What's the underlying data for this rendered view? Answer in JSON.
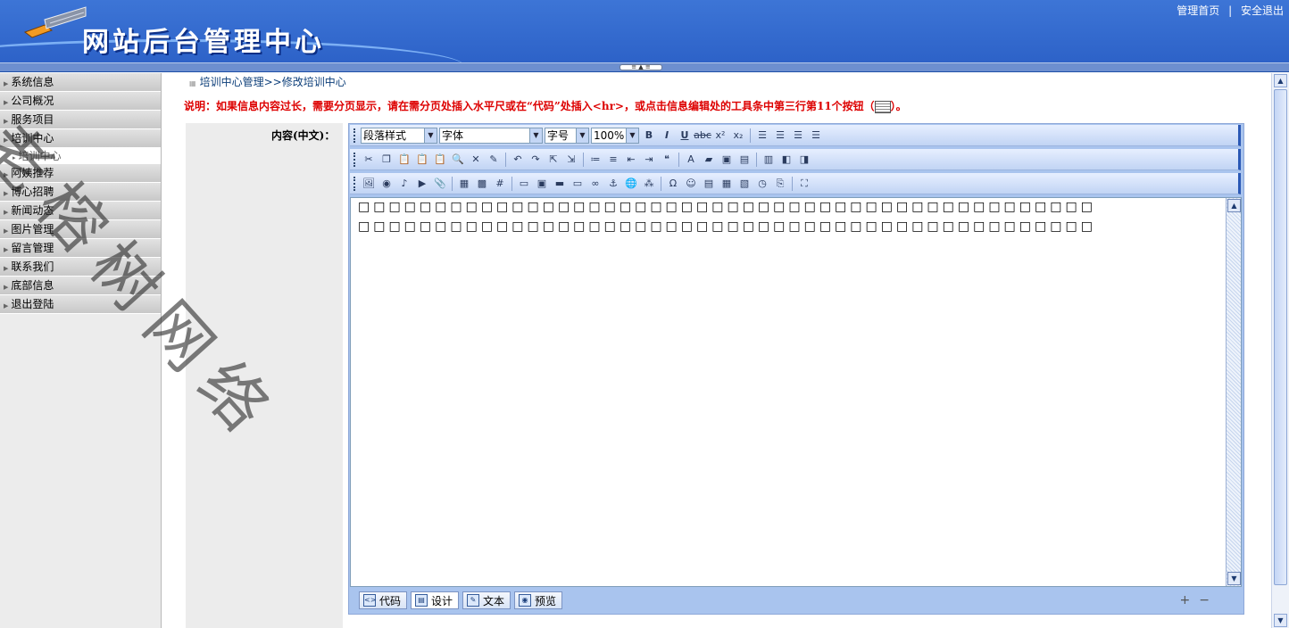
{
  "header": {
    "title": "网站后台管理中心",
    "link_home": "管理首页",
    "separator": "|",
    "link_logout": "安全退出",
    "colors": {
      "header_bg": "#3568d0",
      "accent": "#dd0000"
    }
  },
  "sidebar": {
    "items": [
      {
        "label": "系统信息"
      },
      {
        "label": "公司概况"
      },
      {
        "label": "服务项目"
      },
      {
        "label": "培训中心",
        "sub": "培训中心"
      },
      {
        "label": "阿姨推荐"
      },
      {
        "label": "博心招聘"
      },
      {
        "label": "新闻动态"
      },
      {
        "label": "图片管理"
      },
      {
        "label": "留言管理"
      },
      {
        "label": "联系我们"
      },
      {
        "label": "底部信息"
      },
      {
        "label": "退出登陆"
      }
    ]
  },
  "breadcrumb": {
    "root": "培训中心管理>>",
    "current": "修改培训中心"
  },
  "notice": {
    "text_before": "说明：如果信息内容过长，需要分页显示，请在需分页处插入水平尺或在“代码”处插入<hr>，或点击信息编辑处的工具条中第三行第11个按钮（",
    "text_after": "）。"
  },
  "form": {
    "content_label": "内容(中文)："
  },
  "editor": {
    "paragraph_style": "段落样式",
    "font": "字体",
    "font_size": "字号",
    "zoom": "100%",
    "content_lines": [
      "□□□□□□□□□□□□□□□□□□□□□□□□□□□□□□□□□□□□□□□□□□□□□□□□",
      "□□□□□□□□□□□□□□□□□□□□□□□□□□□□□□□□□□□□□□□□□□□□□□□□"
    ],
    "modes": {
      "code": "代码",
      "design": "设计",
      "text": "文本",
      "preview": "预览"
    },
    "zoom_in": "+",
    "zoom_out": "−"
  },
  "watermark": "老榕树网络"
}
